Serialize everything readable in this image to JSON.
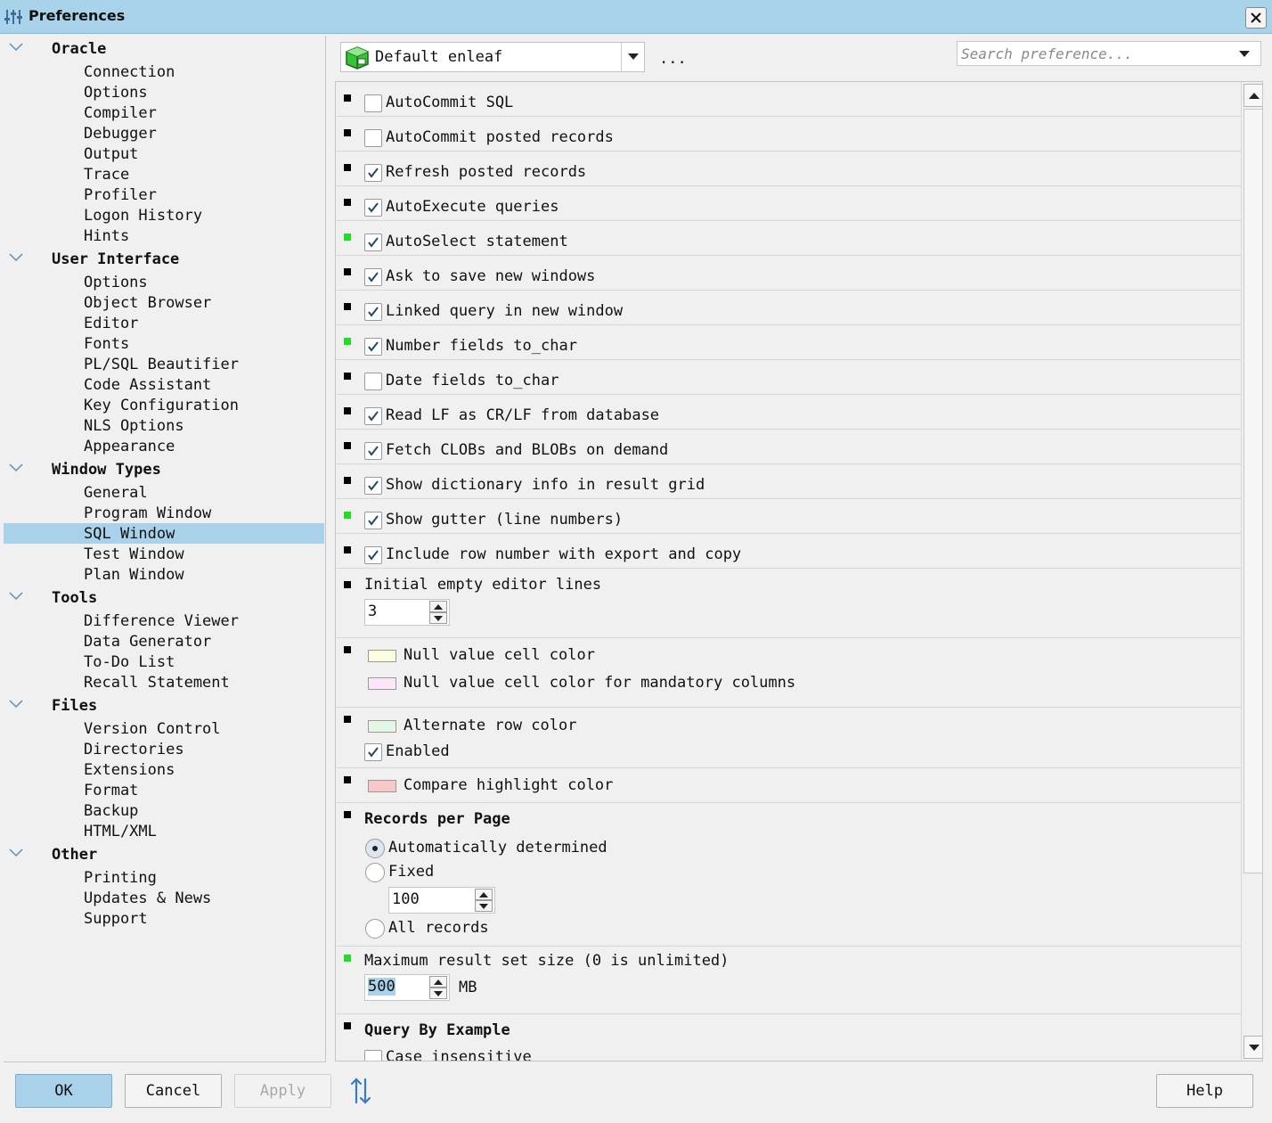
{
  "window": {
    "title": "Preferences"
  },
  "tree": [
    {
      "label": "Oracle",
      "type": "group"
    },
    {
      "label": "Connection",
      "type": "leaf"
    },
    {
      "label": "Options",
      "type": "leaf"
    },
    {
      "label": "Compiler",
      "type": "leaf"
    },
    {
      "label": "Debugger",
      "type": "leaf"
    },
    {
      "label": "Output",
      "type": "leaf"
    },
    {
      "label": "Trace",
      "type": "leaf"
    },
    {
      "label": "Profiler",
      "type": "leaf"
    },
    {
      "label": "Logon History",
      "type": "leaf"
    },
    {
      "label": "Hints",
      "type": "leaf"
    },
    {
      "label": "User Interface",
      "type": "group"
    },
    {
      "label": "Options",
      "type": "leaf"
    },
    {
      "label": "Object Browser",
      "type": "leaf"
    },
    {
      "label": "Editor",
      "type": "leaf"
    },
    {
      "label": "Fonts",
      "type": "leaf"
    },
    {
      "label": "PL/SQL Beautifier",
      "type": "leaf"
    },
    {
      "label": "Code Assistant",
      "type": "leaf"
    },
    {
      "label": "Key Configuration",
      "type": "leaf"
    },
    {
      "label": "NLS Options",
      "type": "leaf"
    },
    {
      "label": "Appearance",
      "type": "leaf"
    },
    {
      "label": "Window Types",
      "type": "group"
    },
    {
      "label": "General",
      "type": "leaf"
    },
    {
      "label": "Program Window",
      "type": "leaf"
    },
    {
      "label": "SQL Window",
      "type": "leaf",
      "selected": true
    },
    {
      "label": "Test Window",
      "type": "leaf"
    },
    {
      "label": "Plan Window",
      "type": "leaf"
    },
    {
      "label": "Tools",
      "type": "group"
    },
    {
      "label": "Difference Viewer",
      "type": "leaf"
    },
    {
      "label": "Data Generator",
      "type": "leaf"
    },
    {
      "label": "To-Do List",
      "type": "leaf"
    },
    {
      "label": "Recall Statement",
      "type": "leaf"
    },
    {
      "label": "Files",
      "type": "group"
    },
    {
      "label": "Version Control",
      "type": "leaf"
    },
    {
      "label": "Directories",
      "type": "leaf"
    },
    {
      "label": "Extensions",
      "type": "leaf"
    },
    {
      "label": "Format",
      "type": "leaf"
    },
    {
      "label": "Backup",
      "type": "leaf"
    },
    {
      "label": "HTML/XML",
      "type": "leaf"
    },
    {
      "label": "Other",
      "type": "group"
    },
    {
      "label": "Printing",
      "type": "leaf"
    },
    {
      "label": "Updates & News",
      "type": "leaf"
    },
    {
      "label": "Support",
      "type": "leaf"
    }
  ],
  "profile": {
    "selected": "Default enleaf",
    "more_label": "..."
  },
  "search": {
    "placeholder": "Search preference..."
  },
  "checkbox_settings": [
    {
      "label": "AutoCommit SQL",
      "checked": false,
      "marker": "black"
    },
    {
      "label": "AutoCommit posted records",
      "checked": false,
      "marker": "black"
    },
    {
      "label": "Refresh posted records",
      "checked": true,
      "marker": "black"
    },
    {
      "label": "AutoExecute queries",
      "checked": true,
      "marker": "black"
    },
    {
      "label": "AutoSelect statement",
      "checked": true,
      "marker": "green"
    },
    {
      "label": "Ask to save new windows",
      "checked": true,
      "marker": "black"
    },
    {
      "label": "Linked query in new window",
      "checked": true,
      "marker": "black"
    },
    {
      "label": "Number fields to_char",
      "checked": true,
      "marker": "green"
    },
    {
      "label": "Date fields to_char",
      "checked": false,
      "marker": "black"
    },
    {
      "label": "Read LF as CR/LF from database",
      "checked": true,
      "marker": "black"
    },
    {
      "label": "Fetch CLOBs and BLOBs on demand",
      "checked": true,
      "marker": "black"
    },
    {
      "label": "Show dictionary info in result grid",
      "checked": true,
      "marker": "black"
    },
    {
      "label": "Show gutter (line numbers)",
      "checked": true,
      "marker": "green"
    },
    {
      "label": "Include row number with export and copy",
      "checked": true,
      "marker": "black"
    }
  ],
  "editor_lines": {
    "label": "Initial empty editor lines",
    "value": "3"
  },
  "null_colors": {
    "null_label": "Null value cell color",
    "null_color": "#fdfde0",
    "mandatory_label": "Null value cell color for mandatory columns",
    "mandatory_color": "#fde6fa"
  },
  "alternate": {
    "label": "Alternate row color",
    "color": "#e4f6e4",
    "enabled_label": "Enabled",
    "enabled_checked": true
  },
  "compare": {
    "label": "Compare highlight color",
    "color": "#f8c8c8"
  },
  "records_per_page": {
    "title": "Records per Page",
    "options": [
      {
        "label": "Automatically determined",
        "selected": true
      },
      {
        "label": "Fixed",
        "selected": false
      },
      {
        "label": "All records",
        "selected": false
      }
    ],
    "fixed_value": "100"
  },
  "max_result": {
    "label": "Maximum result set size (0 is unlimited)",
    "value": "500",
    "unit": "MB"
  },
  "qbe": {
    "title": "Query By Example",
    "first_option": "Case insensitive"
  },
  "buttons": {
    "ok": "OK",
    "cancel": "Cancel",
    "apply": "Apply",
    "help": "Help"
  },
  "colors": {
    "accent": "#a9d2ea",
    "titlebar": "#a8d3ea",
    "marker_green": "#22dd22"
  }
}
